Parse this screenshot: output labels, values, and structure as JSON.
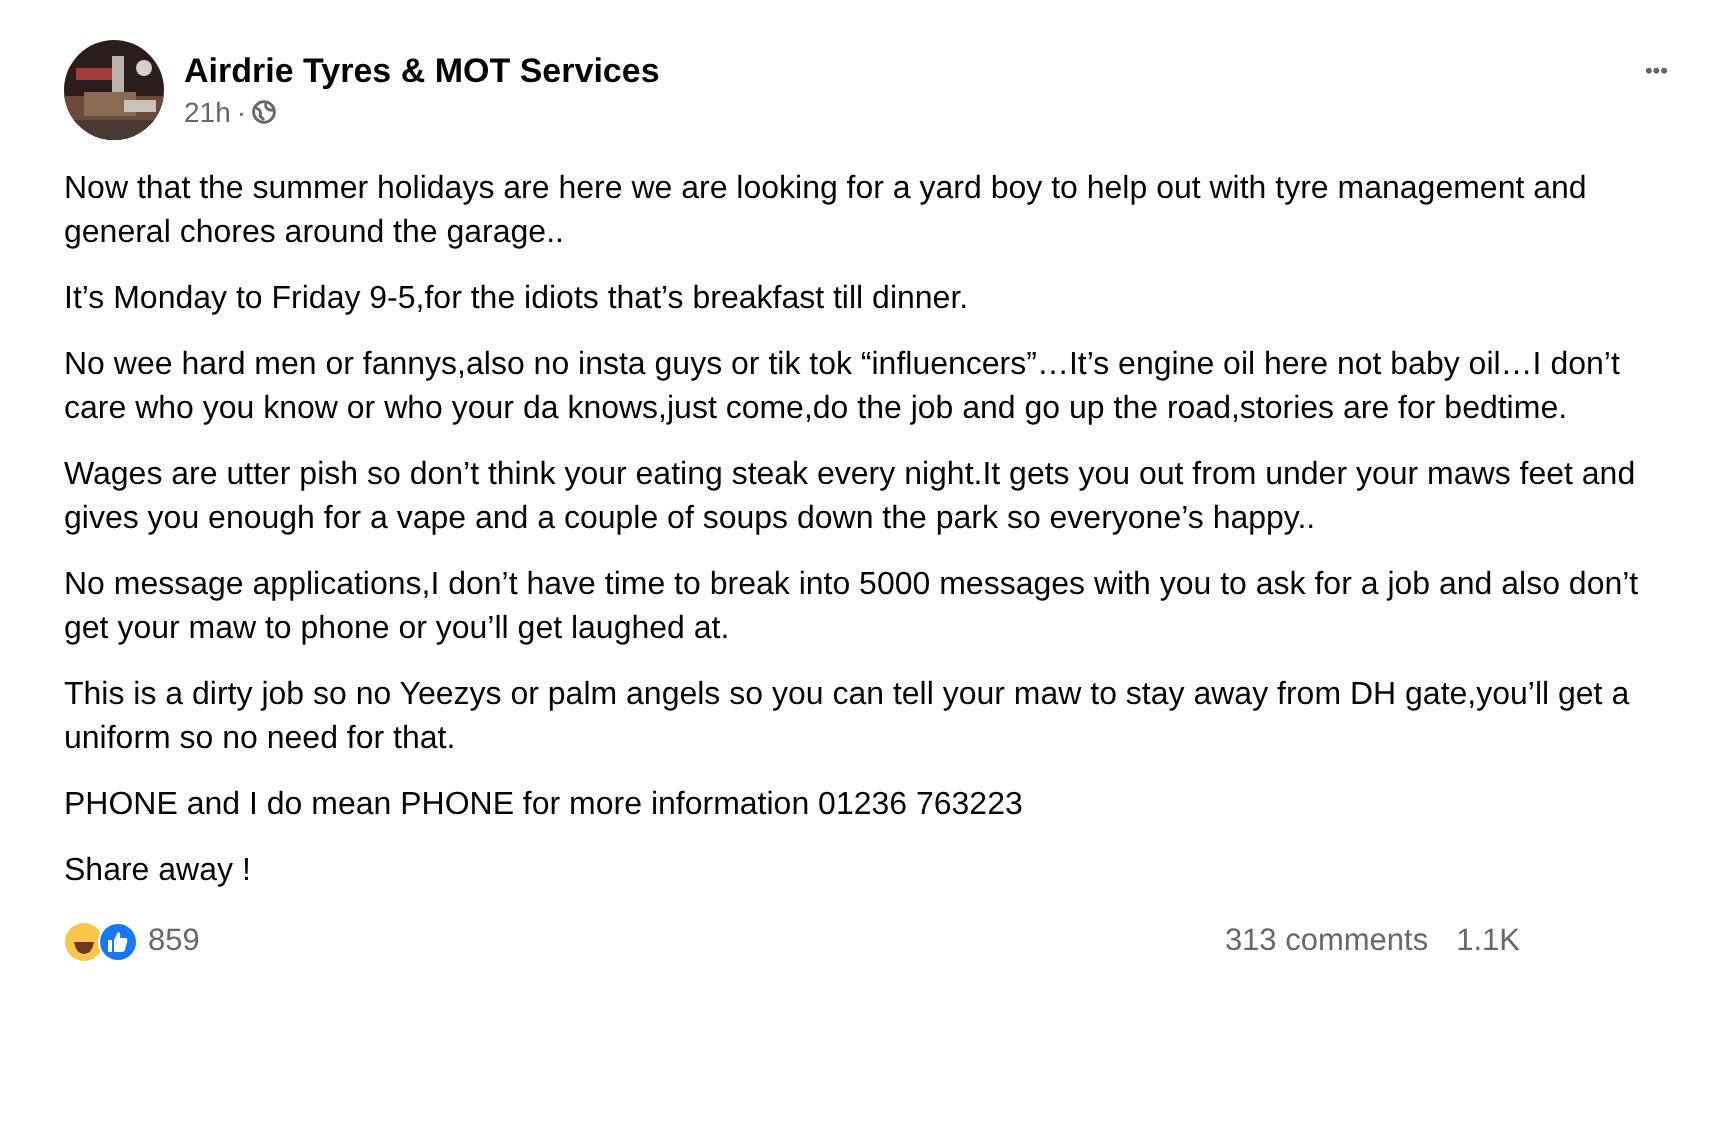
{
  "post": {
    "author": "Airdrie Tyres & MOT Services",
    "time": "21h",
    "separator": "·",
    "more": "•••",
    "paragraphs": [
      "Now that the summer holidays are here we are looking for a yard boy to help out with tyre management and general chores around the garage..",
      "It’s Monday to Friday 9-5,for the idiots that’s breakfast till dinner.",
      "No wee hard men or fannys,also no insta guys or tik tok “influencers”…It’s engine oil here not baby oil…I don’t care who you know or who your da knows,just come,do the job and go up the road,stories are for bedtime.",
      "Wages are utter pish so don’t think your eating steak every night.It gets you out from under your maws feet and gives you enough for a vape and a couple of soups down the park so everyone’s happy..",
      "No message applications,I don’t have time to break into 5000 messages with you to ask for a job and also don’t get your maw to phone or you’ll get laughed at.",
      "This is a dirty job so no Yeezys or palm angels so you can tell your maw to stay away from DH gate,you’ll get a uniform so no need for that.",
      "PHONE and I do mean PHONE for more information 01236 763223",
      "Share away !"
    ],
    "reaction_count": "859",
    "comments": "313 comments",
    "shares": "1.1K"
  }
}
